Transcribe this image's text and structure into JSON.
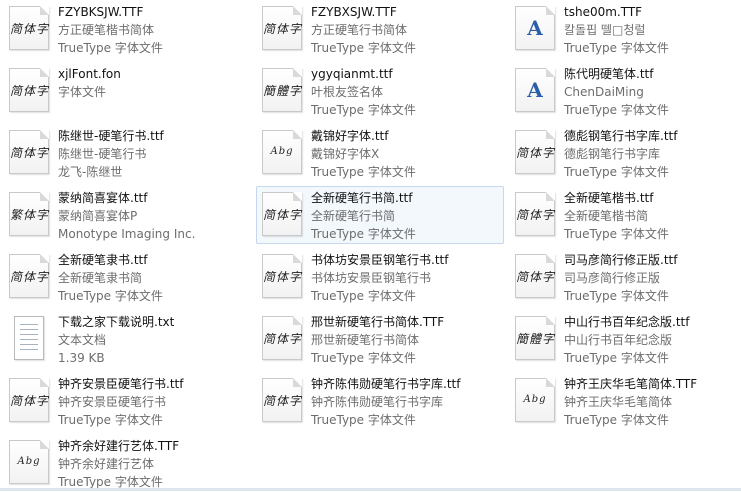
{
  "files": [
    {
      "name": "FZYBKSJW.TTF",
      "line2": "方正硬笔楷书简体",
      "line3": "TrueType 字体文件",
      "preview": "简体字",
      "kind": "font"
    },
    {
      "name": "FZYBXSJW.TTF",
      "line2": "方正硬笔行书简体",
      "line3": "TrueType 字体文件",
      "preview": "简体字",
      "kind": "font"
    },
    {
      "name": "tshe00m.TTF",
      "line2": "칼돌핍 뗄□청럴",
      "line3": "TrueType 字体文件",
      "preview": "A",
      "kind": "font-a"
    },
    {
      "name": "xjlFont.fon",
      "line2": "字体文件",
      "line3": "",
      "preview": "简体字",
      "kind": "font"
    },
    {
      "name": "ygyqianmt.ttf",
      "line2": "叶根友签名体",
      "line3": "TrueType 字体文件",
      "preview": "簡體字",
      "kind": "font"
    },
    {
      "name": "陈代明硬笔体.ttf",
      "line2": "ChenDaiMing",
      "line3": "TrueType 字体文件",
      "preview": "A",
      "kind": "font-a"
    },
    {
      "name": "陈继世-硬笔行书.ttf",
      "line2": "陈继世-硬笔行书",
      "line3": "龙飞-陈继世",
      "preview": "简体字",
      "kind": "font"
    },
    {
      "name": "戴锦好字体.ttf",
      "line2": "戴锦好字体X",
      "line3": "TrueType 字体文件",
      "preview": "Abg",
      "kind": "font-small"
    },
    {
      "name": "德彪钢笔行书字库.ttf",
      "line2": "德彪钢笔行书字库",
      "line3": "TrueType 字体文件",
      "preview": "简体字",
      "kind": "font"
    },
    {
      "name": "蒙纳简喜宴体.ttf",
      "line2": "蒙纳简喜宴体P",
      "line3": "Monotype Imaging Inc.",
      "preview": "繁体字",
      "kind": "font"
    },
    {
      "name": "全新硬笔行书简.ttf",
      "line2": "全新硬笔行书简",
      "line3": "TrueType 字体文件",
      "preview": "简体字",
      "kind": "font"
    },
    {
      "name": "全新硬笔楷书.ttf",
      "line2": "全新硬笔楷书简",
      "line3": "TrueType 字体文件",
      "preview": "简体字",
      "kind": "font"
    },
    {
      "name": "全新硬笔隶书.ttf",
      "line2": "全新硬笔隶书简",
      "line3": "TrueType 字体文件",
      "preview": "简体字",
      "kind": "font"
    },
    {
      "name": "书体坊安景臣钢笔行书.ttf",
      "line2": "书体坊安景臣钢笔行书",
      "line3": "TrueType 字体文件",
      "preview": "简体字",
      "kind": "font"
    },
    {
      "name": "司马彦简行修正版.ttf",
      "line2": "司马彦简行修正版",
      "line3": "TrueType 字体文件",
      "preview": "简体字",
      "kind": "font"
    },
    {
      "name": "下载之家下载说明.txt",
      "line2": "文本文档",
      "line3": "1.39 KB",
      "preview": "",
      "kind": "text"
    },
    {
      "name": "邢世新硬笔行书简体.TTF",
      "line2": "邢世新硬笔行书简体",
      "line3": "TrueType 字体文件",
      "preview": "简体字",
      "kind": "font"
    },
    {
      "name": "中山行书百年纪念版.ttf",
      "line2": "中山行书百年纪念版",
      "line3": "TrueType 字体文件",
      "preview": "簡體字",
      "kind": "font"
    },
    {
      "name": "钟齐安景臣硬笔行书.ttf",
      "line2": "钟齐安景臣硬笔行书",
      "line3": "TrueType 字体文件",
      "preview": "简体字",
      "kind": "font"
    },
    {
      "name": "钟齐陈伟勋硬笔行书字库.ttf",
      "line2": "钟齐陈伟勋硬笔行书字库",
      "line3": "TrueType 字体文件",
      "preview": "简体字",
      "kind": "font"
    },
    {
      "name": "钟齐王庆华毛笔简体.TTF",
      "line2": "钟齐王庆华毛笔简体",
      "line3": "TrueType 字体文件",
      "preview": "Abg",
      "kind": "font-small"
    },
    {
      "name": "钟齐余好建行艺体.TTF",
      "line2": "钟齐余好建行艺体",
      "line3": "TrueType 字体文件",
      "preview": "Abg",
      "kind": "font-small"
    }
  ],
  "selected_file": "全新硬笔行书简.ttf"
}
